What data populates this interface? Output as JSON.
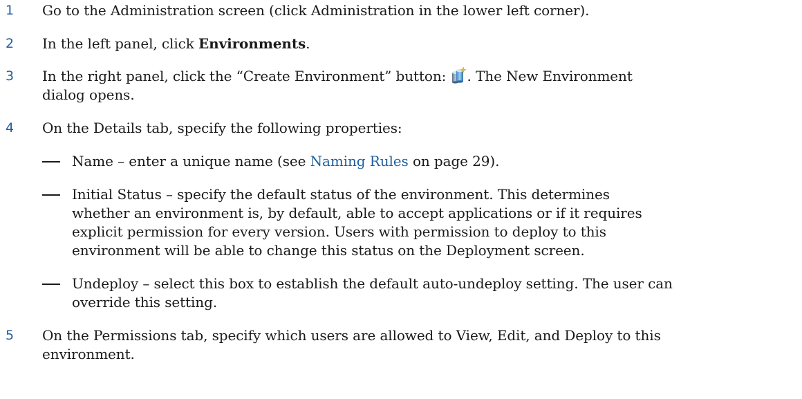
{
  "steps": [
    {
      "number": "1",
      "text": "Go to the Administration screen (click Administration in the lower left corner)."
    },
    {
      "number": "2",
      "before": "In the left panel, click ",
      "bold": "Environments",
      "after": "."
    },
    {
      "number": "3",
      "before": "In the right panel, click the “Create Environment” button: ",
      "icon": "create-environment-icon",
      "after": ". The New Environment",
      "line2": "dialog opens."
    },
    {
      "number": "4",
      "text": "On the Details tab, specify the following properties:",
      "items": [
        {
          "dash": "—",
          "before": "Name – enter a unique name (see ",
          "link": "Naming Rules",
          "after": " on page 29)."
        },
        {
          "dash": "—",
          "lines": [
            "Initial Status – specify the default status of the environment. This determines",
            "whether an environment is, by default, able to accept applications or if it requires",
            "explicit permission for every version. Users with permission to deploy to this",
            "environment will be able to change this status on the Deployment screen."
          ]
        },
        {
          "dash": "—",
          "lines": [
            "Undeploy – select this box to establish the default auto-undeploy setting. The user can",
            "override this setting."
          ]
        }
      ]
    },
    {
      "number": "5",
      "lines": [
        "On the Permissions tab, specify which users are allowed to View, Edit, and Deploy to this",
        "environment."
      ]
    }
  ],
  "colors": {
    "step_number": "#1f5f9f",
    "link": "#1f5f9f",
    "text": "#1a1a1a"
  }
}
